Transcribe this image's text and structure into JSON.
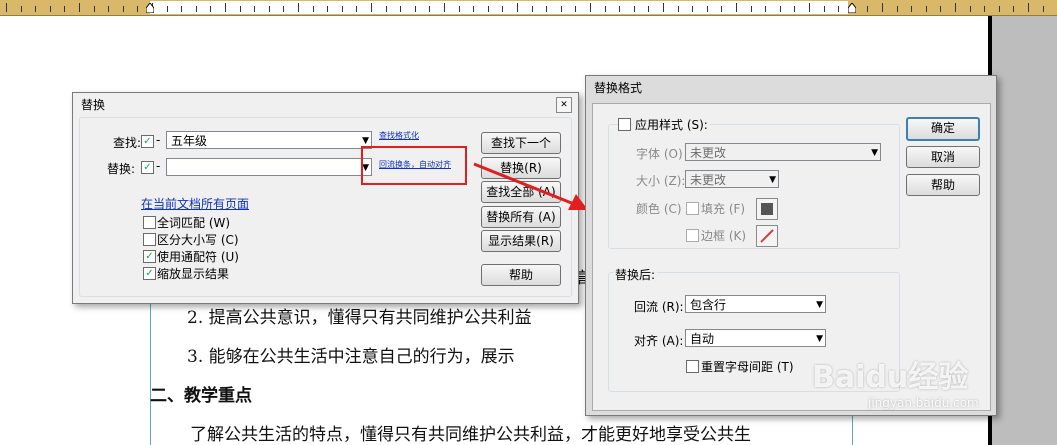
{
  "document": {
    "line1": "2.  提高公共意识，懂得只有共同维护公共利益",
    "line2": "3.  能够在公共生活中注意自己的行为，展示",
    "heading": "二、教学重点",
    "line3": "了解公共生活的特点，懂得只有共同维护公共利益，才能更好地享受公共生",
    "frag_a": "|",
    "frag_b": "（",
    "frag_c": "高"
  },
  "replace_dialog": {
    "title": "替换",
    "close": "✕",
    "find_label": "查找:",
    "find_value": "五年级",
    "replace_label": "替换:",
    "replace_value": "",
    "style_link": "查找格式化",
    "replace_style_link": "回流换条，自动对齐",
    "scope_link": "在当前文档所有页面",
    "options": [
      "全词匹配 (W)",
      "区分大小写 (C)",
      "使用通配符 (U)",
      "缩放显示结果"
    ],
    "buttons": {
      "find_next": "查找下一个",
      "replace": "替换(R)",
      "find_all": "查找全部 (A)",
      "replace_all": "替换所有 (A)",
      "show_results": "显示结果(R)",
      "help": "帮助"
    },
    "dash": "-"
  },
  "format_dialog": {
    "title": "替换格式",
    "apply_style": "应用样式 (S):",
    "font_label": "字体 (O)",
    "font_value": "未更改",
    "size_label": "大小 (Z):",
    "size_value": "未更改",
    "color_label": "颜色 (C)",
    "fill_label": "填充 (F)",
    "border_label": "边框 (K)",
    "after_label": "替换后:",
    "reflow_label": "回流 (R):",
    "reflow_value": "包含行",
    "align_label": "对齐 (A):",
    "align_value": "自动",
    "reset_spacing": "重置字母间距 (T)",
    "buttons": {
      "ok": "确定",
      "cancel": "取消",
      "help": "帮助"
    }
  },
  "watermark": {
    "brand": "Baidu经验",
    "url": "jingyan.baidu.com"
  },
  "colors": {
    "accent": "#3c7fb1",
    "highlight": "#e02020",
    "ruler": "#d9b86a"
  }
}
